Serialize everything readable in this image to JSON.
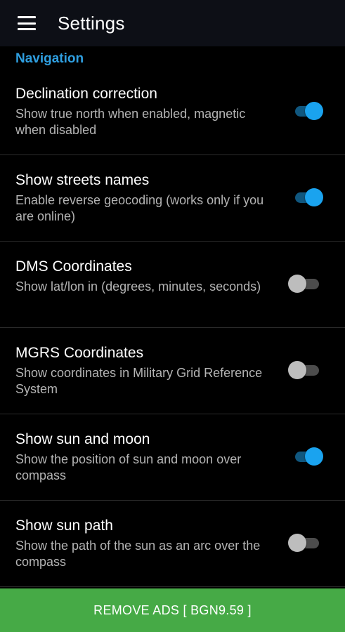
{
  "toolbar": {
    "title": "Settings",
    "menu_icon": "hamburger-menu-icon"
  },
  "section": {
    "title": "Navigation",
    "color": "#2f9fe0"
  },
  "settings": [
    {
      "title": "Declination correction",
      "summary": "Show true north when enabled, magnetic when disabled",
      "enabled": true
    },
    {
      "title": "Show streets names",
      "summary": "Enable reverse geocoding (works only if you are online)",
      "enabled": true
    },
    {
      "title": "DMS Coordinates",
      "summary": "Show lat/lon in (degrees, minutes, seconds)",
      "enabled": false
    },
    {
      "title": "MGRS Coordinates",
      "summary": "Show coordinates in Military Grid Reference System",
      "enabled": false
    },
    {
      "title": "Show sun and moon",
      "summary": "Show the position of sun and moon over compass",
      "enabled": true
    },
    {
      "title": "Show sun path",
      "summary": "Show the path of the sun as an arc over the compass",
      "enabled": false
    }
  ],
  "ads_button": {
    "label": "REMOVE ADS [ BGN9.59 ]",
    "color": "#46aa46"
  },
  "colors": {
    "switch_on_thumb": "#1aa3ef",
    "switch_on_track": "#10577f",
    "switch_off_thumb": "#bdbdbd",
    "switch_off_track": "#4c4c4c"
  }
}
